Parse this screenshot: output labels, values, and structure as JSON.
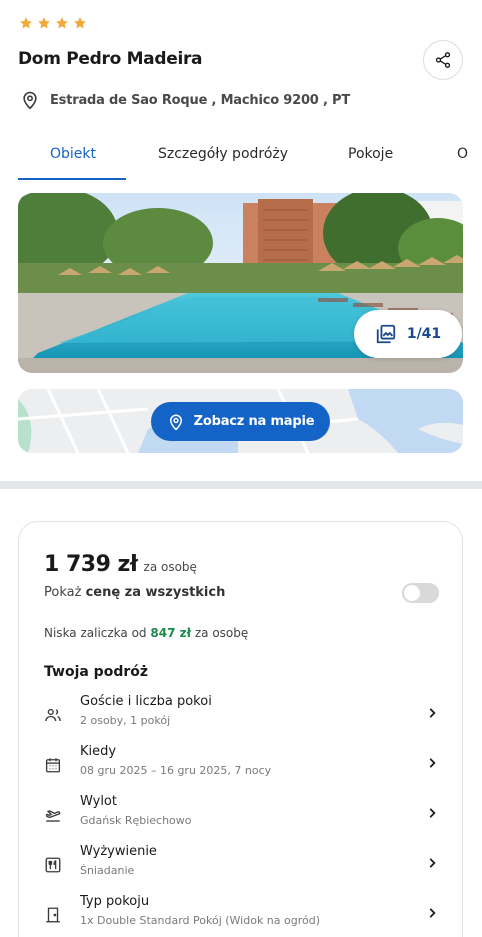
{
  "hotel": {
    "rating_stars": 4,
    "star_color": "#f2a93b",
    "name": "Dom Pedro Madeira",
    "address": "Estrada de Sao Roque , Machico 9200 , PT"
  },
  "tabs": [
    {
      "label": "Obiekt",
      "active": true
    },
    {
      "label": "Szczegóły podróży",
      "active": false
    },
    {
      "label": "Pokoje",
      "active": false
    },
    {
      "label": "O",
      "active": false
    }
  ],
  "gallery": {
    "counter": "1/41"
  },
  "map": {
    "button_label": "Zobacz na mapie"
  },
  "price": {
    "amount": "1 739 zł",
    "unit": "za osobę",
    "toggle_prefix": "Pokaż ",
    "toggle_bold": "cenę za wszystkich",
    "toggle_on": false,
    "deposit_prefix": "Niska zaliczka od ",
    "deposit_amount": "847 zł",
    "deposit_suffix": " za osobę"
  },
  "trip": {
    "title": "Twoja podróż",
    "items": [
      {
        "icon": "guests-icon",
        "label": "Goście i liczba pokoi",
        "value": "2 osoby, 1 pokój"
      },
      {
        "icon": "calendar-icon",
        "label": "Kiedy",
        "value": "08 gru 2025 – 16 gru 2025, 7 nocy"
      },
      {
        "icon": "plane-departure-icon",
        "label": "Wylot",
        "value": "Gdańsk Rębiechowo"
      },
      {
        "icon": "meal-icon",
        "label": "Wyżywienie",
        "value": "Śniadanie"
      },
      {
        "icon": "door-icon",
        "label": "Typ pokoju",
        "value": "1x Double Standard Pokój (Widok na ogród)"
      }
    ]
  },
  "colors": {
    "accent": "#1463c6",
    "deposit_green": "#1a8a4a"
  }
}
